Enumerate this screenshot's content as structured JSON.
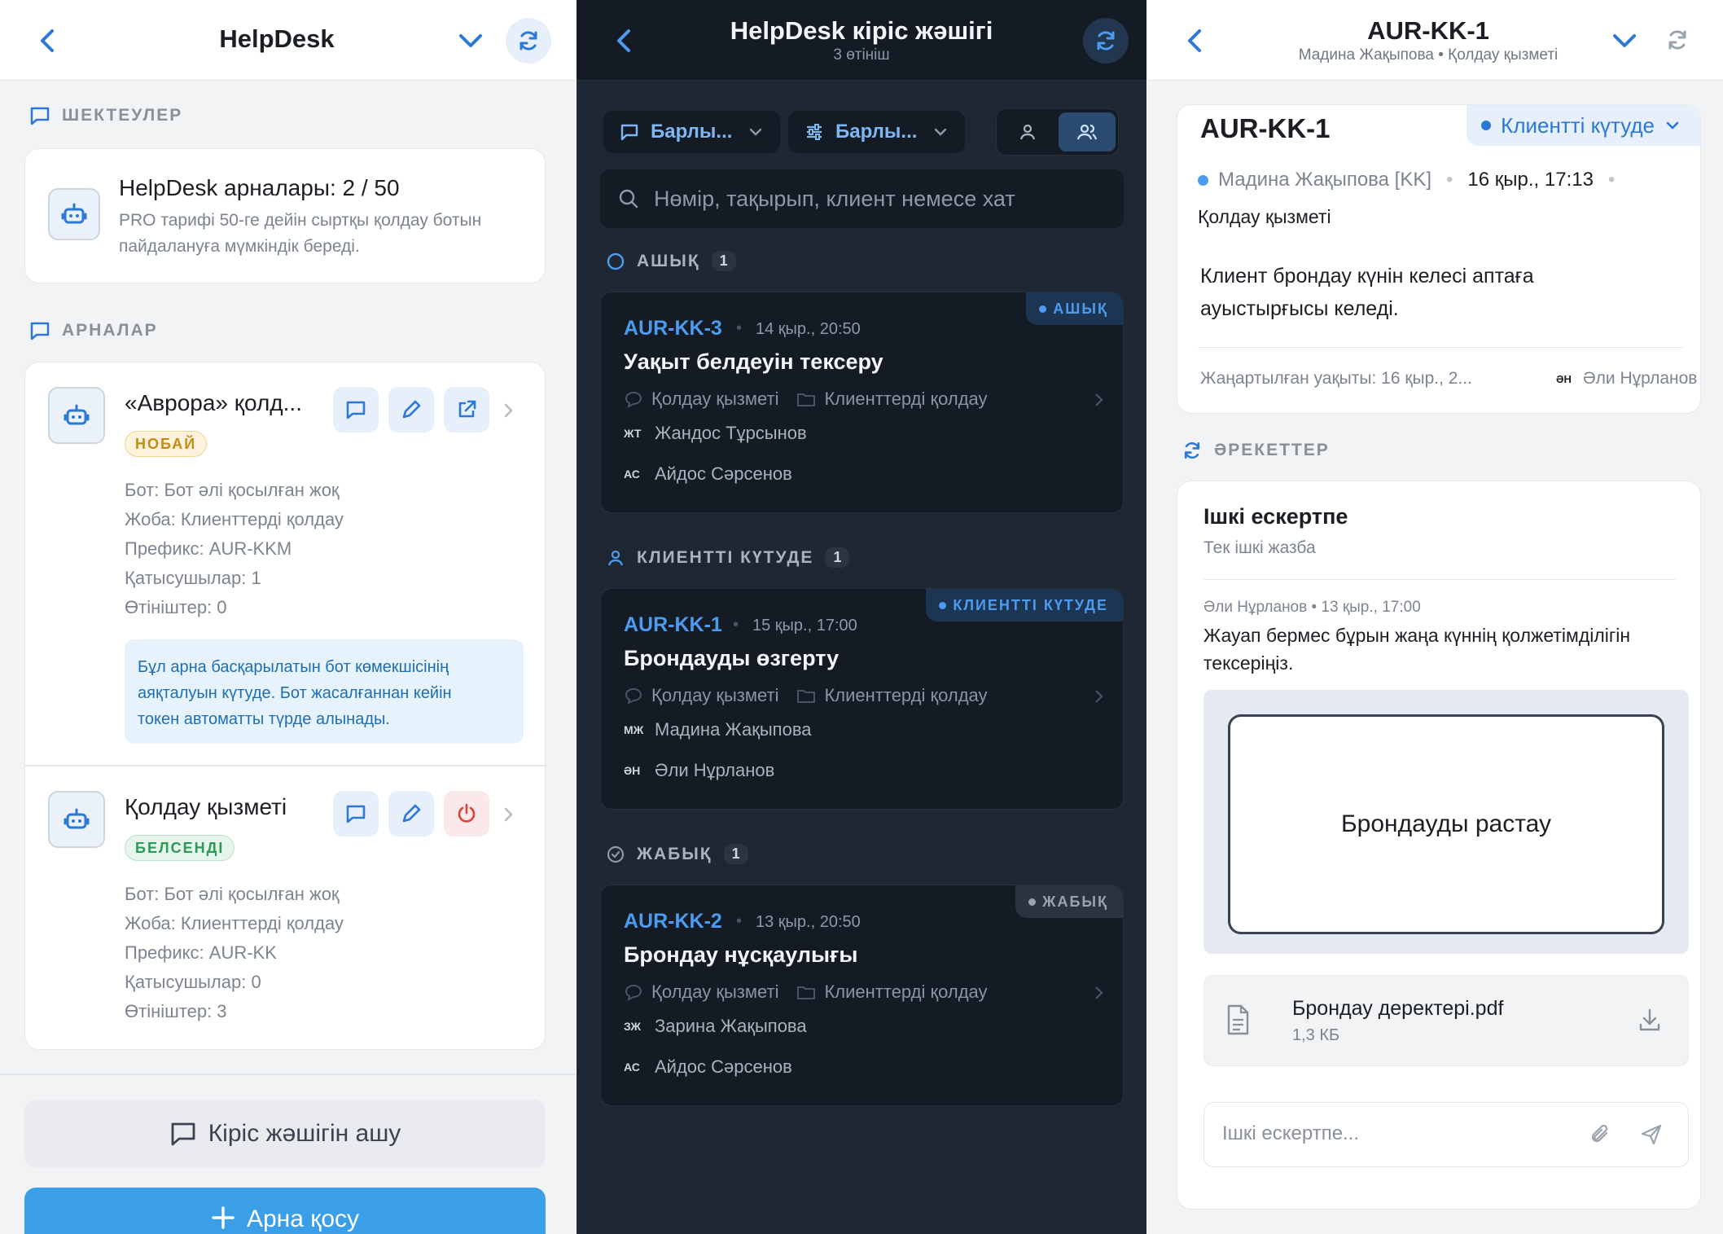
{
  "left": {
    "title": "HelpDesk",
    "limits_label": "ШЕКТЕУЛЕР",
    "limits_card": {
      "title": "HelpDesk арналары: 2 / 50",
      "desc_line1": "PRO тарифі 50-ге дейін сыртқы қолдау ботын",
      "desc_line2": "пайдалануға мүмкіндік береді."
    },
    "channels_label": "АРНАЛАР",
    "channels": [
      {
        "name": "«Аврора» қолд...",
        "badge": "НОБАЙ",
        "bot": "Бот: Бот әлі қосылған жоқ",
        "project": "Жоба: Клиенттерді қолдау",
        "prefix": "Префикс: AUR-KKM",
        "members": "Қатысушылар: 1",
        "tickets": "Өтініштер: 0",
        "note_line1": "Бұл арна басқарылатын бот көмекшісінің",
        "note_line2": "аяқталуын күтуде. Бот жасалғаннан кейін",
        "note_line3": "токен автоматты түрде алынады."
      },
      {
        "name": "Қолдау қызметі",
        "badge": "БЕЛСЕНДІ",
        "bot": "Бот: Бот әлі қосылған жоқ",
        "project": "Жоба: Клиенттерді қолдау",
        "prefix": "Префикс: AUR-KK",
        "members": "Қатысушылар: 0",
        "tickets": "Өтініштер: 3"
      }
    ],
    "open_inbox": "Кіріс жәшігін ашу",
    "add_channel": "Арна қосу",
    "colors": {
      "accent": "#2b78d6",
      "draft": "#c58a13",
      "active": "#2b9a55",
      "primary_btn": "#3a9fe6"
    }
  },
  "middle": {
    "title": "HelpDesk кіріс жәшігі",
    "subtitle": "3 өтініш",
    "filter1": "Барлы...",
    "filter2": "Барлы...",
    "search_placeholder": "Нөмір, тақырып, клиент немесе хат",
    "groups": [
      {
        "label": "АШЫҚ",
        "count": "1",
        "ticket": {
          "id": "AUR-KK-3",
          "date": "14 қыр., 20:50",
          "title": "Уақыт белдеуін тексеру",
          "status": "АШЫҚ",
          "channel": "Қолдау қызметі",
          "project": "Клиенттерді қолдау",
          "client_init": "ЖТ",
          "client": "Жандос Тұрсынов",
          "agent_init": "АС",
          "agent": "Айдос Сәрсенов"
        }
      },
      {
        "label": "КЛИЕНТТІ КҮТУДЕ",
        "count": "1",
        "ticket": {
          "id": "AUR-KK-1",
          "date": "15 қыр., 17:00",
          "title": "Брондауды өзгерту",
          "status": "КЛИЕНТТІ КҮТУДЕ",
          "channel": "Қолдау қызметі",
          "project": "Клиенттерді қолдау",
          "client_init": "МЖ",
          "client": "Мадина Жақыпова",
          "agent_init": "ӘН",
          "agent": "Әли Нұрланов"
        }
      },
      {
        "label": "ЖАБЫҚ",
        "count": "1",
        "ticket": {
          "id": "AUR-KK-2",
          "date": "13 қыр., 20:50",
          "title": "Брондау нұсқаулығы",
          "status": "ЖАБЫҚ",
          "channel": "Қолдау қызметі",
          "project": "Клиенттерді қолдау",
          "client_init": "ЗЖ",
          "client": "Зарина Жақыпова",
          "agent_init": "АС",
          "agent": "Айдос Сәрсенов"
        }
      }
    ],
    "colors": {
      "open": "#4c9bef",
      "waiting": "#4c9bef",
      "closed": "#9aa3af"
    }
  },
  "right": {
    "title": "AUR-KK-1",
    "subtitle": "Мадина Жақыпова • Қолдау қызметі",
    "ticket_id": "AUR-KK-1",
    "status": "Клиентті күтуде",
    "client": "Мадина Жақыпова [KK]",
    "date": "16 қыр., 17:13",
    "channel": "Қолдау қызметі",
    "message_line1": "Клиент брондау күнін келесі аптаға",
    "message_line2": "ауыстырғысы келеді.",
    "updated": "Жаңартылған уақыты: 16 қыр., 2...",
    "agent_init": "ӘН",
    "agent": "Әли Нұрланов",
    "actions_label": "ӘРЕКЕТТЕР",
    "note_title": "Ішкі ескертпе",
    "note_sub": "Тек ішкі жазба",
    "note_author": "Әли Нұрланов • 13 қыр., 17:00",
    "note_line1": "Жауап бермес бұрын жаңа күннің қолжетімділігін",
    "note_line2": "тексеріңіз.",
    "preview_text": "Брондауды растау",
    "file_name": "Брондау деректері.pdf",
    "file_size": "1,3 КБ",
    "input_placeholder": "Ішкі ескертпе..."
  }
}
